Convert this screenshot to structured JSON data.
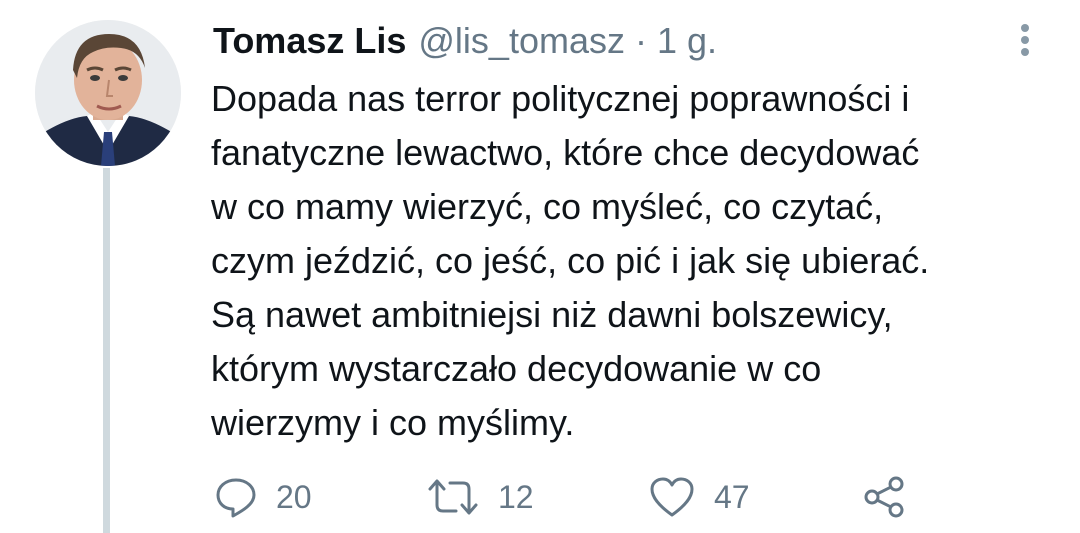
{
  "tweet": {
    "author_name": "Tomasz Lis",
    "handle": "@lis_tomasz",
    "separator": "·",
    "time": "1 g.",
    "text": "Dopada nas terror politycznej poprawności i\nfanatyczne lewactwo, które chce decydować\nw co mamy wierzyć, co myśleć, co czytać,\nczym jeździć, co jeść, co pić i jak się ubierać.\nSą nawet ambitniejsi niż dawni bolszewicy,\nktórym wystarczało decydowanie w co\nwierzymy i co myślimy."
  },
  "actions": {
    "reply_count": "20",
    "retweet_count": "12",
    "like_count": "47"
  },
  "icons": {
    "reply": "speech-bubble-icon",
    "retweet": "retweet-arrows-icon",
    "like": "heart-icon",
    "share": "share-nodes-icon",
    "more": "vertical-ellipsis-icon"
  },
  "colors": {
    "text": "#0f1419",
    "secondary": "#657786",
    "thread_line": "#cfd9de"
  }
}
